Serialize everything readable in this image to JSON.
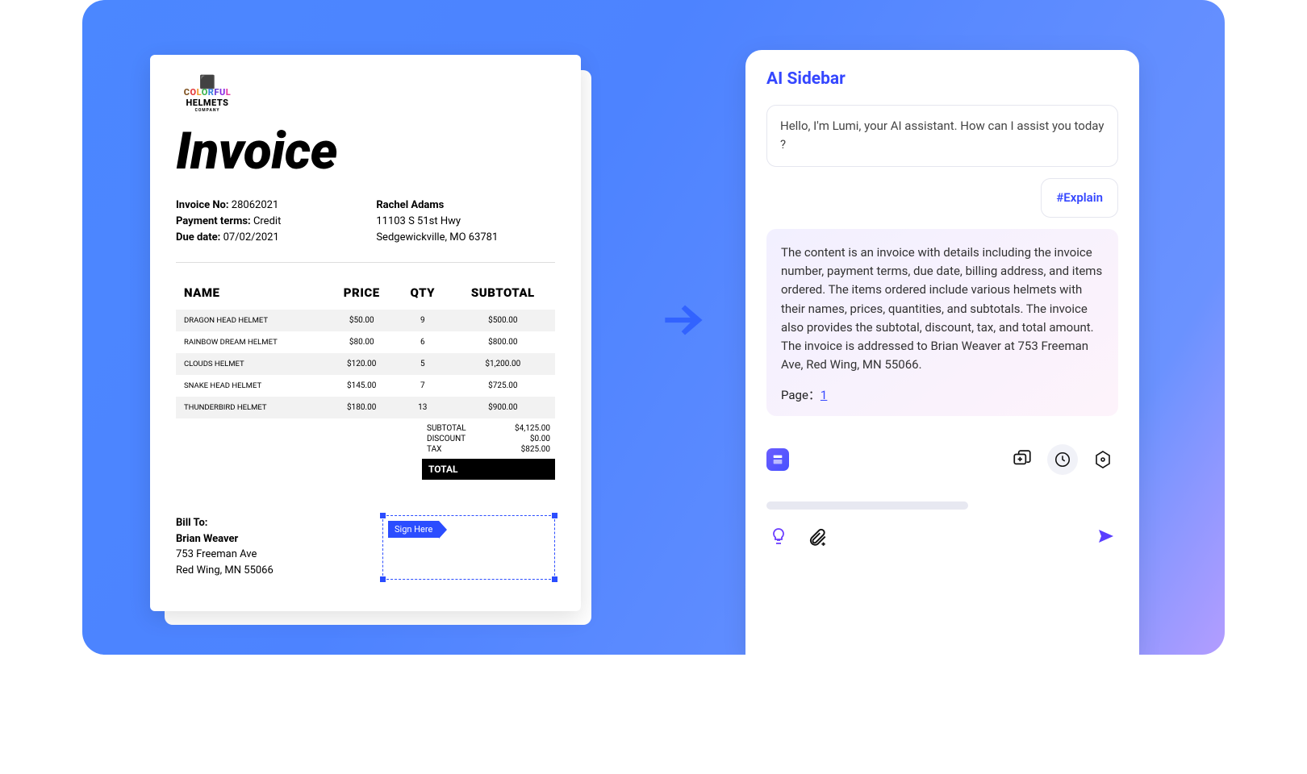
{
  "invoice": {
    "brand": {
      "top": "COLORFUL",
      "bottom": "HELMETS",
      "sub": "COMPANY"
    },
    "heading": "Invoice",
    "meta": {
      "no_label": "Invoice No:",
      "no": "28062021",
      "terms_label": "Payment terms:",
      "terms": "Credit",
      "due_label": "Due date:",
      "due": "07/02/2021"
    },
    "customer": {
      "name": "Rachel Adams",
      "line1": "11103 S 51st Hwy",
      "line2": "Sedgewickville, MO 63781"
    },
    "columns": {
      "name": "NAME",
      "price": "PRICE",
      "qty": "QTY",
      "subtotal": "SUBTOTAL"
    },
    "items": [
      {
        "name": "DRAGON HEAD HELMET",
        "price": "$50.00",
        "qty": "9",
        "subtotal": "$500.00"
      },
      {
        "name": "RAINBOW DREAM HELMET",
        "price": "$80.00",
        "qty": "6",
        "subtotal": "$800.00"
      },
      {
        "name": "CLOUDS HELMET",
        "price": "$120.00",
        "qty": "5",
        "subtotal": "$1,200.00"
      },
      {
        "name": "SNAKE HEAD HELMET",
        "price": "$145.00",
        "qty": "7",
        "subtotal": "$725.00"
      },
      {
        "name": "THUNDERBIRD HELMET",
        "price": "$180.00",
        "qty": "13",
        "subtotal": "$900.00"
      }
    ],
    "totals": {
      "subtotal_label": "SUBTOTAL",
      "subtotal": "$4,125.00",
      "discount_label": "DISCOUNT",
      "discount": "$0.00",
      "tax_label": "TAX",
      "tax": "$825.00",
      "total_label": "TOTAL"
    },
    "bill_to": {
      "label": "Bill To:",
      "name": "Brian Weaver",
      "line1": "753 Freeman Ave",
      "line2": "Red Wing, MN 55066"
    },
    "sign_here": "Sign Here"
  },
  "ai": {
    "title": "AI Sidebar",
    "greeting": "Hello, I'm Lumi, your AI assistant. How can I assist you today ?",
    "tag": "#Explain",
    "response": "The content is an invoice with details including the invoice number, payment terms, due date, billing address, and items ordered. The items ordered include various helmets with their names, prices, quantities, and subtotals. The invoice also provides the subtotal, discount, tax, and total amount. The invoice is addressed to Brian Weaver at 753 Freeman Ave, Red Wing, MN 55066.",
    "page_label": "Page：",
    "page_link": "1"
  }
}
